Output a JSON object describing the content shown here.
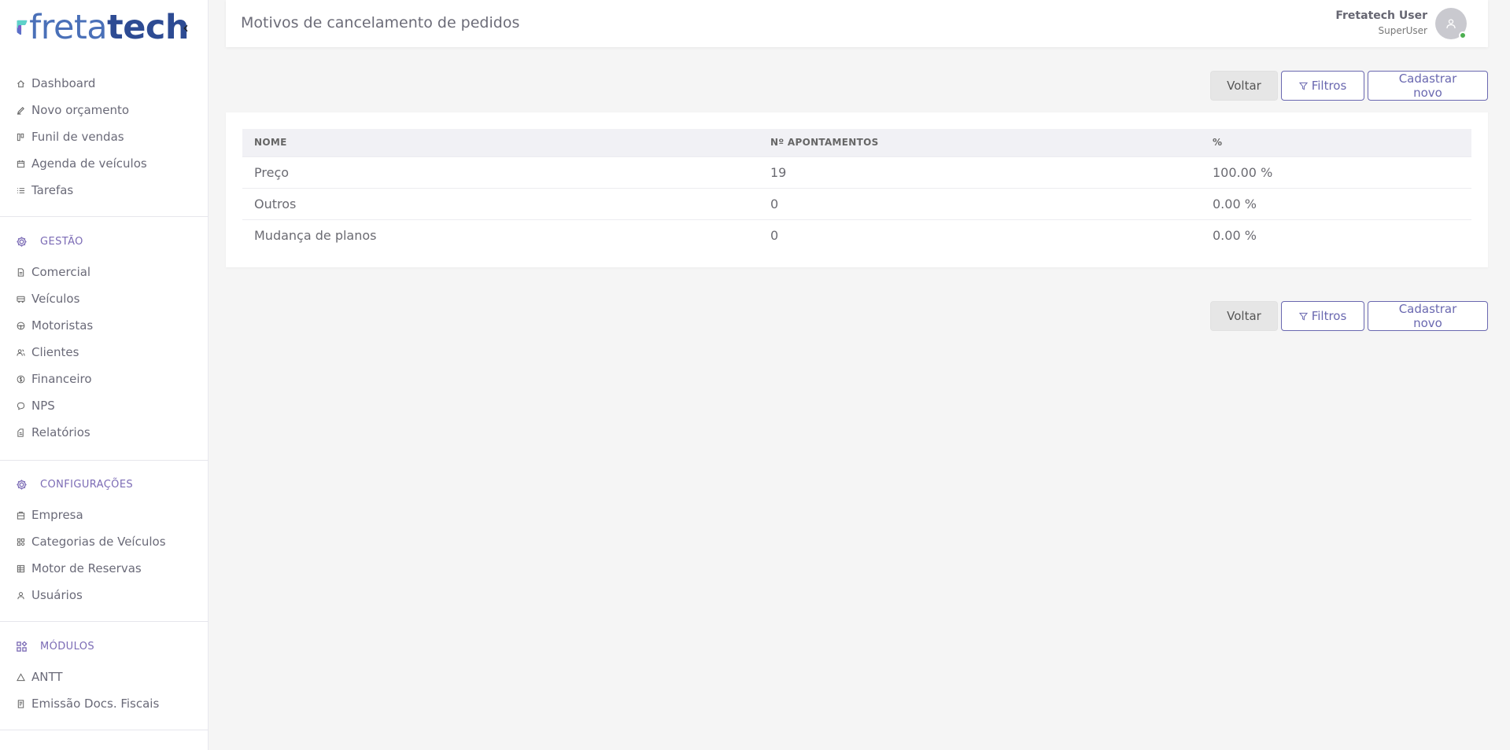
{
  "brand": {
    "logo_part1": "freta",
    "logo_part2": "tech",
    "primary_color": "#6a68b0",
    "section_color": "#7b6bb5"
  },
  "sidebar": {
    "collapse_icon": "chevron-left-icon",
    "main": [
      {
        "label": "Dashboard",
        "icon": "home-icon"
      },
      {
        "label": "Novo orçamento",
        "icon": "edit-icon"
      },
      {
        "label": "Funil de vendas",
        "icon": "funnel-icon"
      },
      {
        "label": "Agenda de veículos",
        "icon": "calendar-icon"
      },
      {
        "label": "Tarefas",
        "icon": "list-icon"
      }
    ],
    "gestao": {
      "title": "GESTÃO",
      "items": [
        {
          "label": "Comercial",
          "icon": "document-icon"
        },
        {
          "label": "Veículos",
          "icon": "bus-icon"
        },
        {
          "label": "Motoristas",
          "icon": "steering-wheel-icon"
        },
        {
          "label": "Clientes",
          "icon": "users-icon"
        },
        {
          "label": "Financeiro",
          "icon": "dollar-icon"
        },
        {
          "label": "NPS",
          "icon": "chat-icon"
        },
        {
          "label": "Relatórios",
          "icon": "report-icon"
        }
      ]
    },
    "configuracoes": {
      "title": "CONFIGURAÇÕES",
      "items": [
        {
          "label": "Empresa",
          "icon": "building-icon"
        },
        {
          "label": "Categorias de Veículos",
          "icon": "category-icon"
        },
        {
          "label": "Motor de Reservas",
          "icon": "table-icon"
        },
        {
          "label": "Usuários",
          "icon": "user-icon"
        }
      ]
    },
    "modulos": {
      "title": "MÓDULOS",
      "items": [
        {
          "label": "ANTT",
          "icon": "triangle-icon"
        },
        {
          "label": "Emissão Docs. Fiscais",
          "icon": "receipt-icon"
        }
      ]
    }
  },
  "header": {
    "title": "Motivos de cancelamento de pedidos",
    "user_name": "Fretatech User",
    "user_role": "SuperUser",
    "status_color": "#4caf50"
  },
  "actions": {
    "back": "Voltar",
    "filters": "Filtros",
    "new": "Cadastrar novo"
  },
  "table": {
    "columns": [
      "NOME",
      "Nº APONTAMENTOS",
      "%"
    ],
    "rows": [
      [
        "Preço",
        "19",
        "100.00 %"
      ],
      [
        "Outros",
        "0",
        "0.00 %"
      ],
      [
        "Mudança de planos",
        "0",
        "0.00 %"
      ]
    ]
  }
}
